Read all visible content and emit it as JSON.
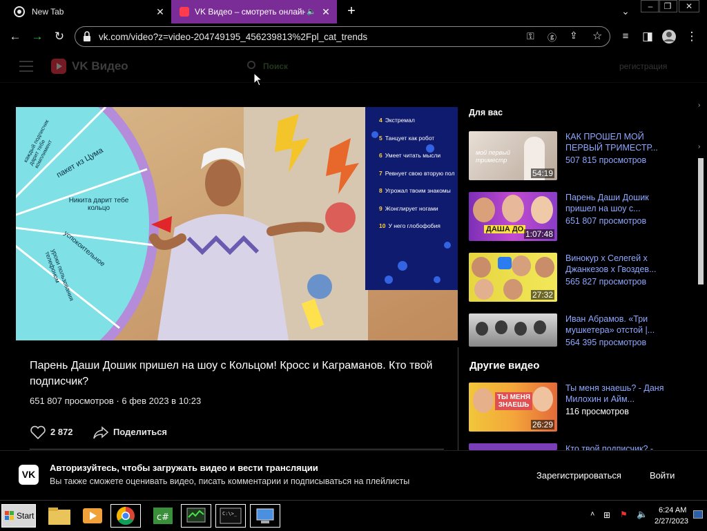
{
  "browser": {
    "tabs": [
      {
        "title": "New Tab"
      },
      {
        "title": "VK Видео – смотреть онлайн"
      }
    ],
    "url": "vk.com/video?z=video-204749195_456239813%2Fpl_cat_trends"
  },
  "vk_header": {
    "brand": "VK Видео",
    "search_placeholder": "Поиск",
    "register_link": "регистрация"
  },
  "player": {
    "wheel_labels": [
      "каждый подписчик дарит тебе комплимент",
      "пакет из Цума",
      "Никита дарит тебе кольцо",
      "успокоительное",
      "уроки пользования телефоном"
    ],
    "board_items": [
      {
        "num": "4",
        "text": "Экстремал"
      },
      {
        "num": "5",
        "text": "Танцует как робот"
      },
      {
        "num": "6",
        "text": "Умеет читать мысли"
      },
      {
        "num": "7",
        "text": "Ревнует свою вторую пол"
      },
      {
        "num": "8",
        "text": "Угрожал твоим знакомы"
      },
      {
        "num": "9",
        "text": "Жонглирует ногами"
      },
      {
        "num": "10",
        "text": "У него глобофобия"
      }
    ]
  },
  "video": {
    "title": "Парень Даши Дошик пришел на шоу с Кольцом! Кросс и Каграманов. Кто твой подписчик?",
    "meta": "651 807 просмотров · 6 фев 2023 в 10:23",
    "likes": "2 872",
    "share_label": "Поделиться"
  },
  "sidebar": {
    "for_you_title": "Для вас",
    "for_you": [
      {
        "title": "КАК ПРОШЕЛ МОЙ ПЕРВЫЙ ТРИМЕСТР...",
        "views": "507 815 просмотров",
        "duration": "54:19",
        "thumb_text": "мой первый триместр"
      },
      {
        "title": "Парень Даши Дошик пришел на шоу с...",
        "views": "651 807 просмотров",
        "duration": "1:07:48",
        "thumb_text": "ДАША ДО"
      },
      {
        "title": "Винокур x Селегей x Джанкезов x Гвоздев...",
        "views": "565 827 просмотров",
        "duration": "27:32"
      },
      {
        "title": "Иван Абрамов. «Три мушкетера» отстой |...",
        "views": "564 395 просмотров",
        "duration": ""
      }
    ],
    "other_title": "Другие видео",
    "other": [
      {
        "title": "Ты меня знаешь? - Даня Милохин и Айм...",
        "views": "116 просмотров",
        "duration": "26:29",
        "thumb_text": "ТЫ МЕНЯ ЗНАЕШЬ"
      },
      {
        "title": "Кто твой подписчик? -",
        "views": "",
        "duration": ""
      }
    ]
  },
  "auth_banner": {
    "logo": "VK",
    "heading": "Авторизуйтесь, чтобы загружать видео и вести трансляции",
    "sub": "Вы также сможете оценивать видео, писать комментарии и подписываться на плейлисты",
    "register": "Зарегистрироваться",
    "login": "Войти"
  },
  "taskbar": {
    "start": "Start",
    "time": "6:24 AM",
    "date": "2/27/2023"
  }
}
